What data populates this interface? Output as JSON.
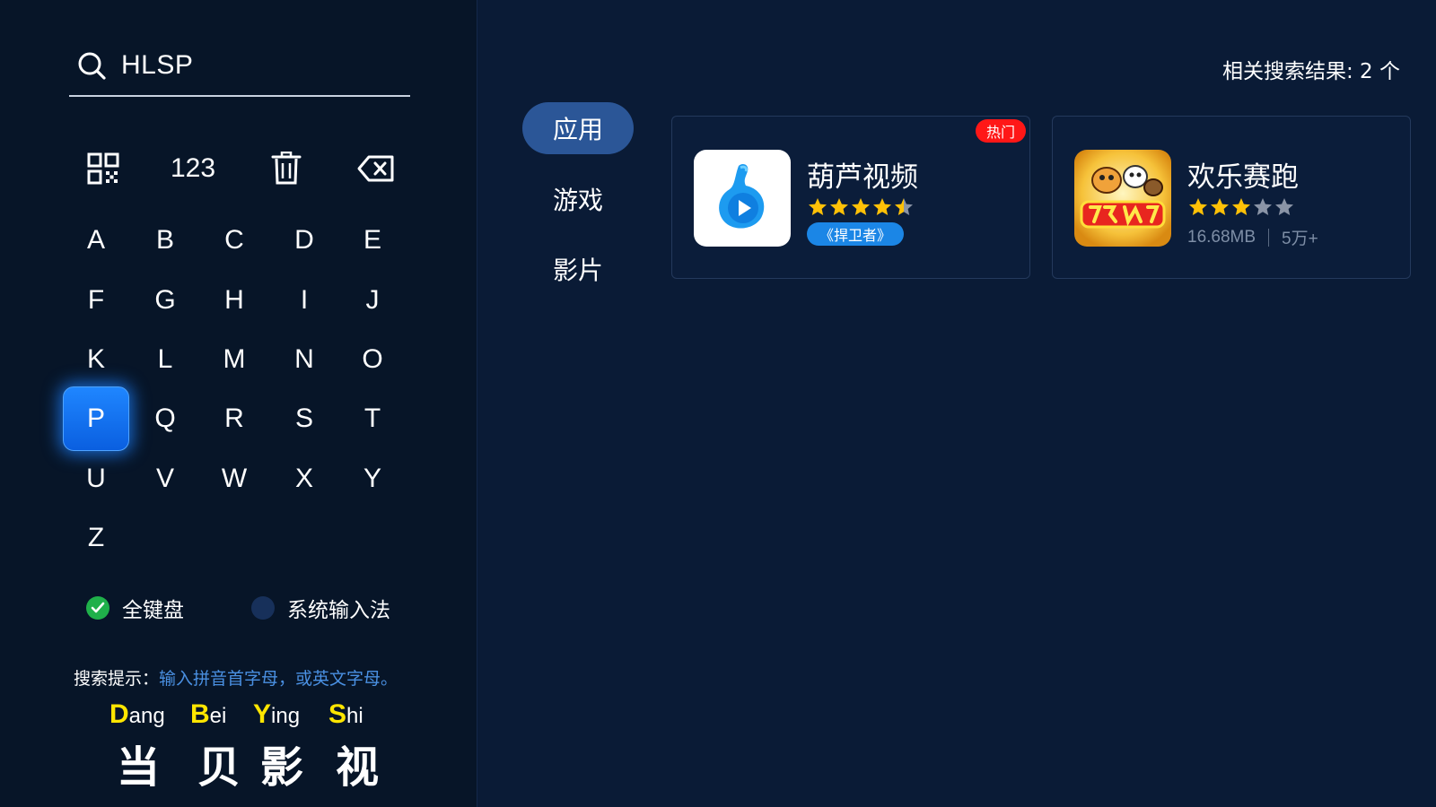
{
  "search": {
    "query": "HLSP",
    "icon": "search-icon"
  },
  "tools": {
    "qr_icon": "qr-code-icon",
    "numeric_label": "123",
    "clear_icon": "trash-icon",
    "backspace_icon": "backspace-icon"
  },
  "keyboard": {
    "keys": [
      "A",
      "B",
      "C",
      "D",
      "E",
      "F",
      "G",
      "H",
      "I",
      "J",
      "K",
      "L",
      "M",
      "N",
      "O",
      "P",
      "Q",
      "R",
      "S",
      "T",
      "U",
      "V",
      "W",
      "X",
      "Y",
      "Z"
    ],
    "focused_key": "P"
  },
  "input_modes": {
    "full_keyboard": {
      "label": "全键盘",
      "selected": true
    },
    "system_ime": {
      "label": "系统输入法",
      "selected": false
    }
  },
  "hint": {
    "label": "搜索提示：",
    "text": "输入拼音首字母，或英文字母。"
  },
  "brand": {
    "columns": [
      {
        "cap": "D",
        "rest": "ang",
        "hanzi": "当"
      },
      {
        "cap": "B",
        "rest": "ei",
        "hanzi": "贝"
      },
      {
        "cap": "Y",
        "rest": "ing",
        "hanzi": "影"
      },
      {
        "cap": "S",
        "rest": "hi",
        "hanzi": "视"
      }
    ]
  },
  "results": {
    "count_text": "相关搜索结果: 2 个"
  },
  "categories": [
    {
      "label": "应用",
      "active": true
    },
    {
      "label": "游戏",
      "active": false
    },
    {
      "label": "影片",
      "active": false
    }
  ],
  "apps": [
    {
      "name": "葫芦视频",
      "rating": 4.5,
      "tag": "《捍卫者》",
      "badge": "热门",
      "icon": "gourd-play-icon"
    },
    {
      "name": "欢乐赛跑",
      "rating": 3,
      "size": "16.68MB",
      "downloads": "5万+",
      "icon": "happy-race-game-icon"
    }
  ],
  "colors": {
    "background": "#0a1b36",
    "left_panel": "#071528",
    "focused_key": "#1f86ff",
    "active_category": "#2b5697",
    "star": "#ffc107",
    "hot_badge": "#ff1717",
    "tag": "#1b86e6",
    "check": "#1fb04a",
    "hint_text": "#4a90e2",
    "brand_capital": "#ffe600"
  }
}
